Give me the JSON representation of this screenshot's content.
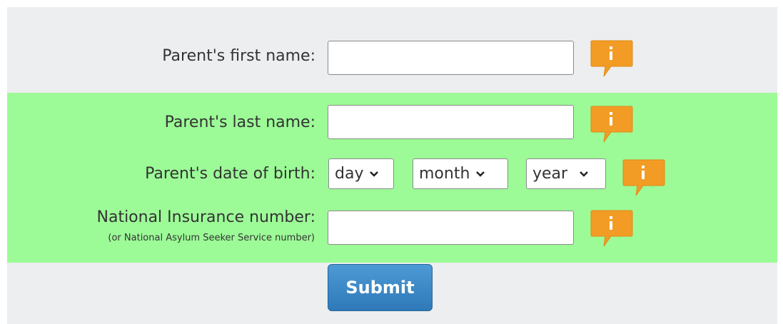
{
  "form": {
    "first_name": {
      "label": "Parent's first name:",
      "value": "",
      "info_icon": "info-icon"
    },
    "last_name": {
      "label": "Parent's last name:",
      "value": "",
      "info_icon": "info-icon"
    },
    "dob": {
      "label": "Parent's date of birth:",
      "day": "day",
      "month": "month",
      "year": "year",
      "info_icon": "info-icon"
    },
    "ni_number": {
      "label": "National Insurance number:",
      "sublabel": "(or National Asylum Seeker Service number)",
      "value": "",
      "info_icon": "info-icon"
    },
    "submit_label": "Submit"
  },
  "colors": {
    "panel_bg": "#eceeef",
    "highlight_bg": "#9cfb97",
    "info_orange": "#f39c25",
    "submit_blue": "#3683c4"
  }
}
